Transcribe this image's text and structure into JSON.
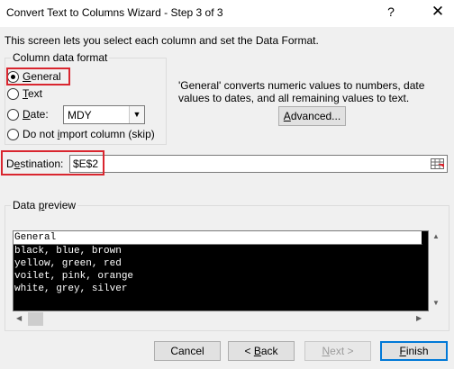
{
  "window": {
    "title": "Convert Text to Columns Wizard - Step 3 of 3",
    "help_glyph": "?",
    "close_glyph": "✕"
  },
  "intro_text": "This screen lets you select each column and set the Data Format.",
  "column_format": {
    "title": "Column data format",
    "options": [
      {
        "label_pre": "",
        "accel": "G",
        "label_post": "eneral",
        "checked": true
      },
      {
        "label_pre": "",
        "accel": "T",
        "label_post": "ext",
        "checked": false
      },
      {
        "label_pre": "",
        "accel": "D",
        "label_post": "ate:",
        "checked": false
      },
      {
        "label_pre": "Do not ",
        "accel": "i",
        "label_post": "mport column (skip)",
        "checked": false
      }
    ],
    "date_format": "MDY"
  },
  "description": "'General' converts numeric values to numbers, date values to dates, and all remaining values to text.",
  "advanced_button": {
    "accel": "A",
    "rest": "dvanced..."
  },
  "destination": {
    "label_pre": "D",
    "accel": "e",
    "label_post": "stination:",
    "value": "$E$2"
  },
  "preview": {
    "title_pre": "Data ",
    "accel": "p",
    "title_post": "review",
    "header": "General",
    "rows": [
      "black, blue, brown",
      "yellow, green, red",
      "voilet, pink, orange",
      "white, grey, silver"
    ]
  },
  "buttons": {
    "cancel": "Cancel",
    "back": {
      "pre": "< ",
      "accel": "B",
      "post": "ack"
    },
    "next": {
      "accel": "N",
      "post": "ext >"
    },
    "finish": {
      "accel": "F",
      "post": "inish"
    }
  },
  "colors": {
    "highlight": "#d9262f",
    "focus": "#0078d7"
  }
}
